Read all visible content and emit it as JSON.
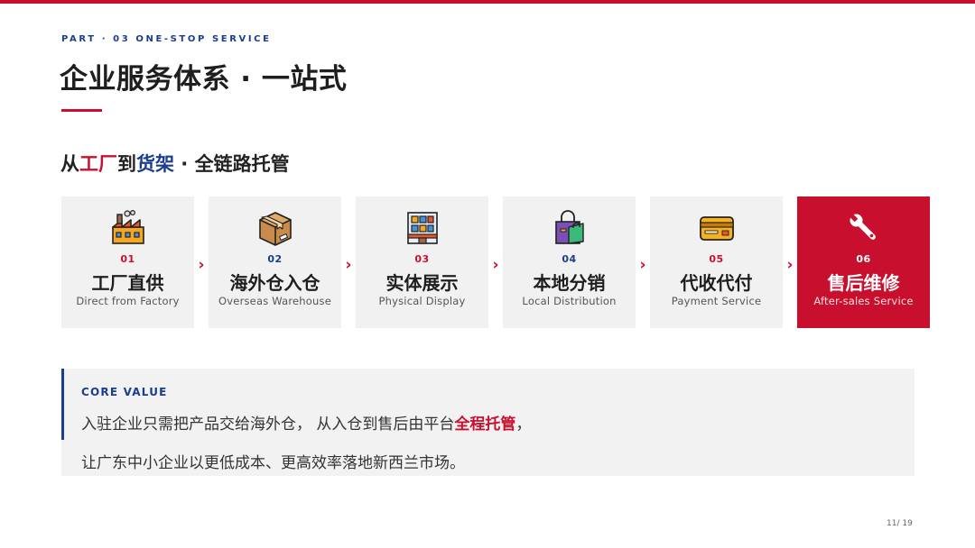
{
  "header": {
    "part_label": "PART · 03 ONE-STOP SERVICE",
    "title": "企业服务体系 · 一站式"
  },
  "subtitle": {
    "prefix": "从",
    "highlight_red": "工厂",
    "middle": "到",
    "highlight_blue": "货架",
    "suffix": " · 全链路托管"
  },
  "steps": [
    {
      "num": "01",
      "cn": "工厂直供",
      "en": "Direct from Factory",
      "icon": "factory-icon"
    },
    {
      "num": "02",
      "cn": "海外仓入仓",
      "en": "Overseas Warehouse",
      "icon": "package-icon"
    },
    {
      "num": "03",
      "cn": "实体展示",
      "en": "Physical Display",
      "icon": "storefront-icon"
    },
    {
      "num": "04",
      "cn": "本地分销",
      "en": "Local Distribution",
      "icon": "shopping-bag-icon"
    },
    {
      "num": "05",
      "cn": "代收代付",
      "en": "Payment Service",
      "icon": "credit-card-icon"
    },
    {
      "num": "06",
      "cn": "售后维修",
      "en": "After-sales Service",
      "icon": "wrench-icon"
    }
  ],
  "arrow_glyph": "›",
  "core_value": {
    "label": "CORE VALUE",
    "line1_prefix": "入驻企业只需把产品交给海外仓， 从入仓到售后由平台",
    "line1_highlight": "全程托管",
    "line1_suffix": "，",
    "line2": "让广东中小企业以更低成本、更高效率落地新西兰市场。"
  },
  "footer": {
    "page": "11/ 19"
  },
  "colors": {
    "accent_red": "#c8102e",
    "accent_blue": "#1a3d8f",
    "card_bg": "#f1f1f1"
  }
}
